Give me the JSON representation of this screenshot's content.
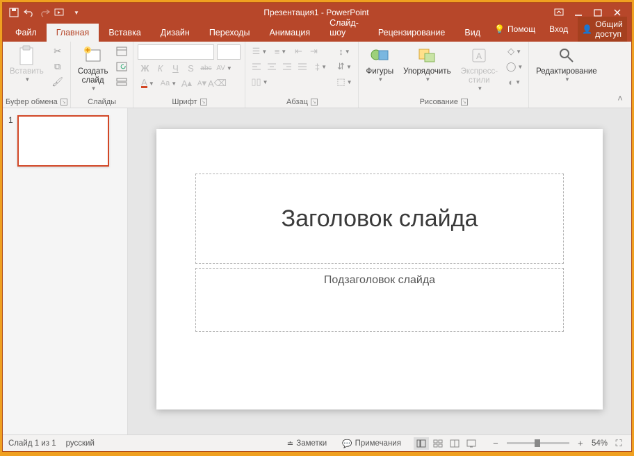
{
  "title": "Презентация1 - PowerPoint",
  "tabs": {
    "file": "Файл",
    "home": "Главная",
    "insert": "Вставка",
    "design": "Дизайн",
    "transitions": "Переходы",
    "animations": "Анимация",
    "slideshow": "Слайд-шоу",
    "review": "Рецензирование",
    "view": "Вид"
  },
  "titlebar_right": {
    "help": "Помощ",
    "signin": "Вход",
    "share": "Общий доступ"
  },
  "groups": {
    "clipboard": {
      "label": "Буфер обмена",
      "paste": "Вставить"
    },
    "slides": {
      "label": "Слайды",
      "new_slide": "Создать\nслайд"
    },
    "font": {
      "label": "Шрифт"
    },
    "paragraph": {
      "label": "Абзац"
    },
    "drawing": {
      "label": "Рисование",
      "shapes": "Фигуры",
      "arrange": "Упорядочить",
      "express": "Экспресс-\nстили"
    },
    "editing": {
      "label": "",
      "editing": "Редактирование"
    }
  },
  "slide": {
    "title_placeholder": "Заголовок слайда",
    "subtitle_placeholder": "Подзаголовок слайда"
  },
  "thumb": {
    "num": "1"
  },
  "status": {
    "slide_count": "Слайд 1 из 1",
    "language": "русский",
    "notes": "Заметки",
    "comments": "Примечания",
    "zoom": "54%"
  },
  "font_controls": {
    "bold": "Ж",
    "italic": "К",
    "underline": "Ч",
    "strike": "S",
    "shadow": "abc",
    "spacing": "AV",
    "case": "Aa",
    "clear": "A",
    "grow": "A",
    "shrink": "A",
    "color": "A"
  }
}
